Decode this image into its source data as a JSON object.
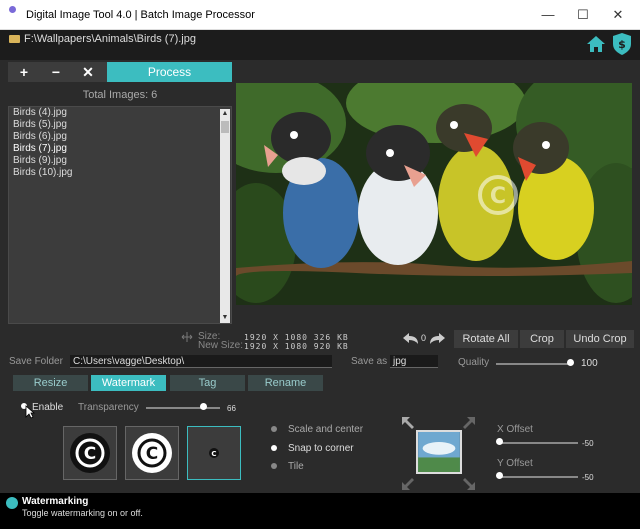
{
  "window": {
    "title": "Digital Image Tool 4.0  |  Batch Image Processor",
    "minimize": "—",
    "maximize": "☐",
    "close": "✕"
  },
  "path": "F:\\Wallpapers\\Animals\\Birds (7).jpg",
  "toolbar": {
    "add": "+",
    "remove": "−",
    "clear": "✕",
    "process": "Process"
  },
  "total_images": "Total Images: 6",
  "files": [
    "Birds (4).jpg",
    "Birds (5).jpg",
    "Birds (6).jpg",
    "Birds (7).jpg",
    "Birds (9).jpg",
    "Birds (10).jpg"
  ],
  "info": {
    "size_label": "Size:",
    "size_value": "1920 X 1080  326 KB",
    "new_size_label": "New Size:",
    "new_size_value": "1920 X 1080  920 KB",
    "rotate_count": "0"
  },
  "actions": {
    "rotate_all": "Rotate  All",
    "crop": "Crop",
    "undo_crop": "Undo  Crop"
  },
  "save": {
    "folder_label": "Save  Folder",
    "folder_value": "C:\\Users\\vagge\\Desktop\\",
    "save_as_label": "Save  as",
    "format_value": "jpg",
    "quality_label": "Quality",
    "quality_value": "100"
  },
  "tabs": [
    "Resize",
    "Watermark",
    "Tag",
    "Rename"
  ],
  "watermark": {
    "enable_label": "Enable",
    "transparency_label": "Transparency",
    "transparency_value": "66",
    "mode_options": [
      "Scale  and  center",
      "Snap  to  corner",
      "Tile"
    ],
    "x_offset_label": "X  Offset",
    "x_offset_value": "-50",
    "y_offset_label": "Y  Offset",
    "y_offset_value": "-50"
  },
  "status": {
    "title": "Watermarking",
    "description": "Toggle watermarking on or off."
  },
  "colors": {
    "accent": "#3cbdc0",
    "background": "#2b2b2b",
    "panel": "#3c3c3c"
  }
}
